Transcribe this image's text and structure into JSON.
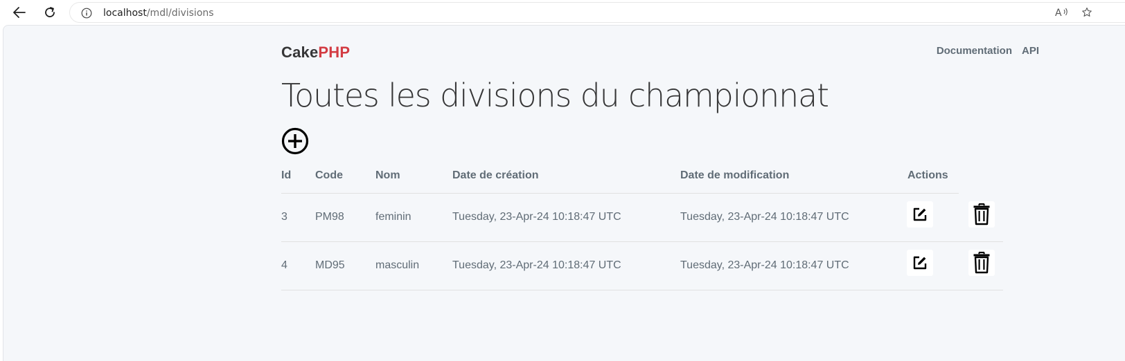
{
  "browser": {
    "url_host": "localhost",
    "url_path": "/mdl/divisions",
    "icons": [
      "back-arrow-icon",
      "reload-icon",
      "info-icon",
      "read-aloud-icon",
      "favorite-star-icon"
    ]
  },
  "header": {
    "logo_part1": "Cake",
    "logo_part2": "PHP",
    "nav": [
      {
        "label": "Documentation"
      },
      {
        "label": "API"
      }
    ]
  },
  "main": {
    "title": "Toutes les divisions du championnat",
    "add_icon": "plus-circle-icon"
  },
  "table": {
    "columns": [
      "Id",
      "Code",
      "Nom",
      "Date de création",
      "Date de modification",
      "Actions"
    ],
    "rows": [
      {
        "id": "3",
        "code": "PM98",
        "nom": "feminin",
        "created": "Tuesday, 23-Apr-24 10:18:47 UTC",
        "modified": "Tuesday, 23-Apr-24 10:18:47 UTC"
      },
      {
        "id": "4",
        "code": "MD95",
        "nom": "masculin",
        "created": "Tuesday, 23-Apr-24 10:18:47 UTC",
        "modified": "Tuesday, 23-Apr-24 10:18:47 UTC"
      }
    ],
    "row_icons": [
      "edit-icon",
      "trash-icon"
    ]
  },
  "colors": {
    "brand_red": "#d33c43",
    "text_dark": "#363637",
    "text_muted": "#606c76",
    "background": "#f5f7fa"
  }
}
